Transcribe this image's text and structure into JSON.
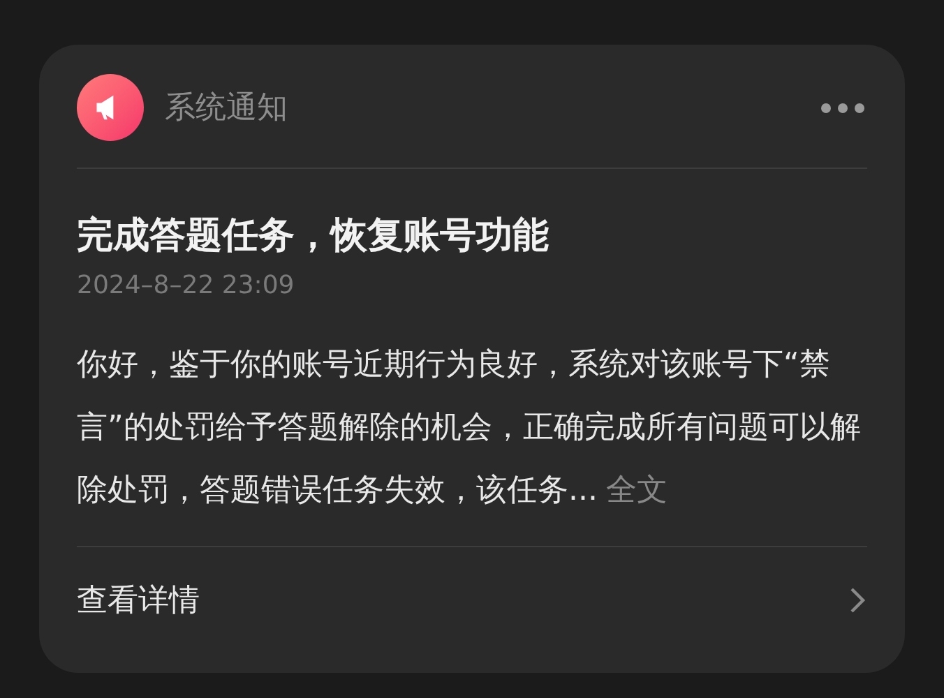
{
  "header": {
    "title": "系统通知"
  },
  "notice": {
    "title": "完成答题任务，恢复账号功能",
    "date": "2024–8–22 23:09",
    "body": "你好，鉴于你的账号近期行为良好，系统对该账号下“禁言”的处罚给予答题解除的机会，正确完成所有问题可以解除处罚，答题错误任务失效，该任务...",
    "more": "全文"
  },
  "footer": {
    "label": "查看详情"
  }
}
